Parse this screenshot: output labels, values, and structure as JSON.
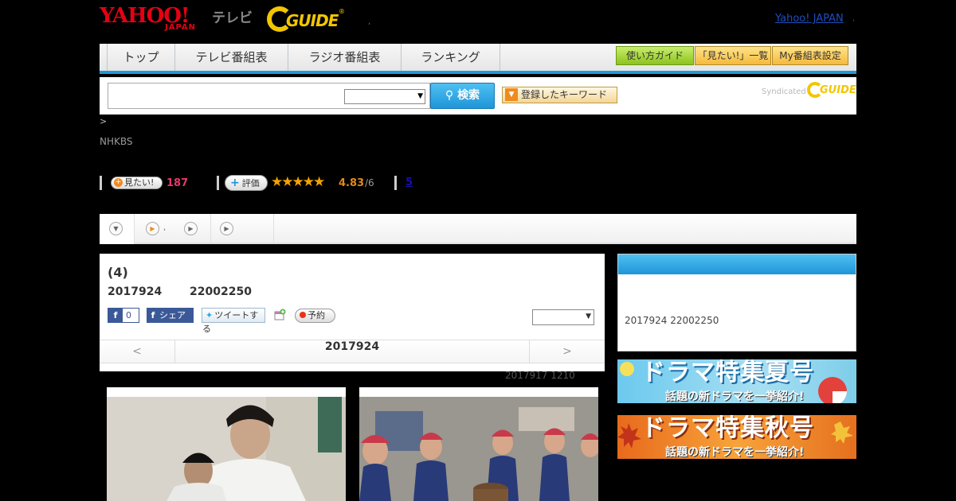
{
  "header": {
    "yahoo_logo": "YAHOO!",
    "yahoo_logo_sub": "JAPAN",
    "tv_label": "テレビ",
    "gguide_logo": "GUIDE",
    "gguide_reg": "®",
    "sep_dot": ",",
    "yahoo_japan_link": "Yahoo! JAPAN",
    "trail_dot": ","
  },
  "nav": {
    "tabs": [
      "トップ",
      "テレビ番組表",
      "ラジオ番組表",
      "ランキング"
    ],
    "guide_button": "使い方ガイド",
    "mitai_list_button": "「見たい!」一覧",
    "my_schedule_button": "My番組表設定"
  },
  "search": {
    "placeholder": "",
    "select_value": "",
    "button_label": "検索",
    "keyword_button": "登録したキーワード",
    "syndicated": "Syndicated",
    "syn_logo": "GUIDE"
  },
  "breadcrumb": {
    "arrow": ">"
  },
  "channel": "NHKBS",
  "rating_row": {
    "mitai_label": "見たい!",
    "mitai_count": "187",
    "hyoka_label": "評価",
    "stars": "★★★★★",
    "score": "4.83",
    "score_max": "/6",
    "review_count": "5"
  },
  "tabs_bar": {
    "tab2_text": ","
  },
  "program": {
    "episode": "(4)",
    "date": "2017924",
    "time": "22002250",
    "fb_like_count": "0",
    "fb_share": "シェア",
    "tweet": "ツイートする",
    "yoyaku": "予約",
    "panel_select_value": ""
  },
  "date_nav": {
    "prev": "<",
    "current": "2017924",
    "next": ">"
  },
  "update_info": "2017917  1210",
  "sidebar": {
    "air_info": "2017924  22002250"
  },
  "banners": {
    "summer_title": "ドラマ特集夏号",
    "summer_sub": "話題の新ドラマを一挙紹介!",
    "autumn_title": "ドラマ特集秋号",
    "autumn_sub": "話題の新ドラマを一挙紹介!"
  },
  "colors": {
    "accent_blue": "#1f95d8",
    "yahoo_red": "#e60013",
    "gguide_yellow": "#f2c600",
    "mitai_pink": "#e33a6b",
    "star_orange": "#f5a300"
  }
}
